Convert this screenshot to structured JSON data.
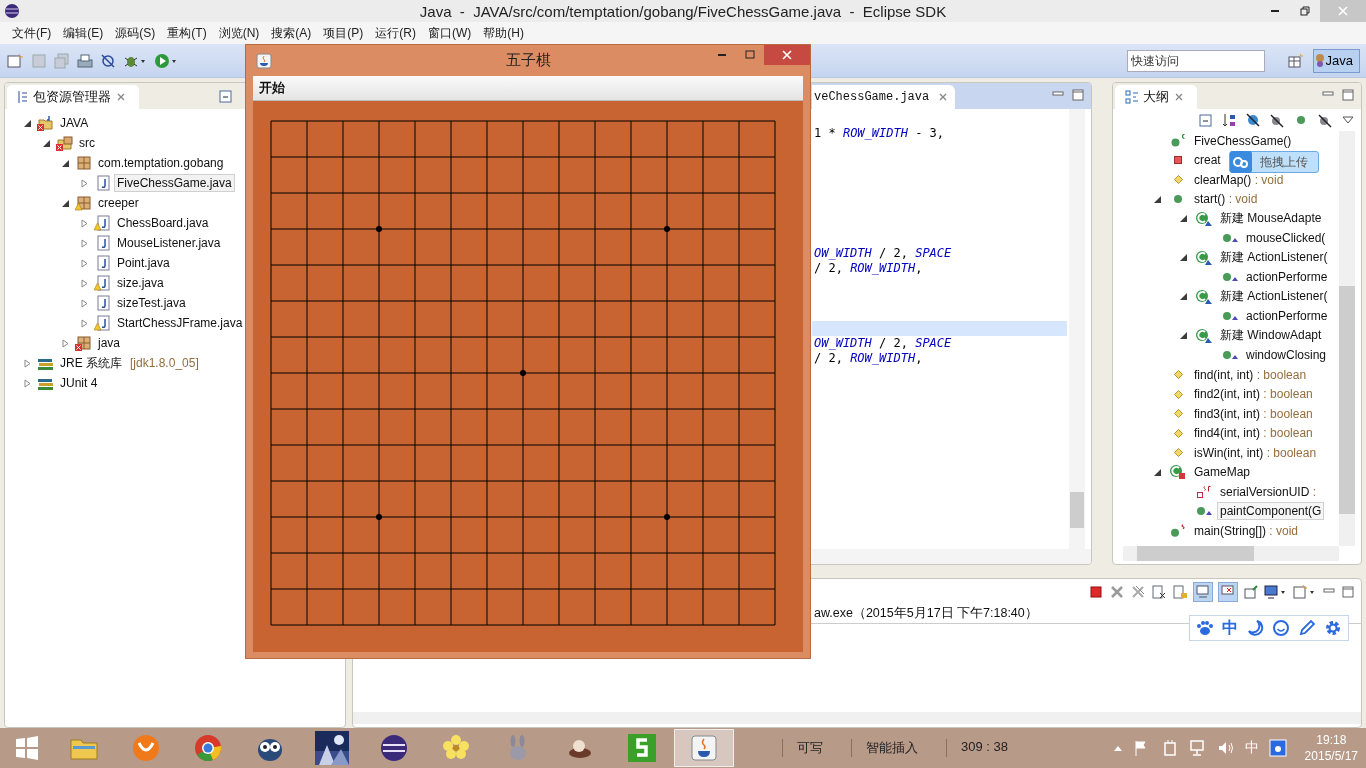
{
  "window": {
    "title": "Java  -  JAVA/src/com/temptation/gobang/FiveChessGame.java  -  Eclipse SDK"
  },
  "menu": [
    "文件(F)",
    "编辑(E)",
    "源码(S)",
    "重构(T)",
    "浏览(N)",
    "搜索(A)",
    "项目(P)",
    "运行(R)",
    "窗口(W)",
    "帮助(H)"
  ],
  "quick_access": {
    "placeholder": "快速访问"
  },
  "perspective": {
    "label": "Java",
    "selected": true
  },
  "package_explorer": {
    "tab": "包资源管理器",
    "tree": [
      {
        "label": "JAVA",
        "kind": "project",
        "error": true,
        "warning": false,
        "expanded": true,
        "selected": false,
        "children": [
          {
            "label": "src",
            "kind": "source-folder",
            "error": true,
            "warning": false,
            "expanded": true,
            "selected": false,
            "children": [
              {
                "label": "com.temptation.gobang",
                "kind": "package",
                "error": false,
                "warning": false,
                "expanded": true,
                "selected": false,
                "children": [
                  {
                    "label": "FiveChessGame.java",
                    "kind": "java-file",
                    "error": false,
                    "warning": false,
                    "expanded": false,
                    "selected": true
                  }
                ]
              },
              {
                "label": "creeper",
                "kind": "package",
                "error": false,
                "warning": true,
                "expanded": true,
                "selected": false,
                "children": [
                  {
                    "label": "ChessBoard.java",
                    "kind": "java-file",
                    "error": false,
                    "warning": true,
                    "expanded": false,
                    "selected": false
                  },
                  {
                    "label": "MouseListener.java",
                    "kind": "java-file",
                    "error": false,
                    "warning": false,
                    "expanded": false,
                    "selected": false
                  },
                  {
                    "label": "Point.java",
                    "kind": "java-file",
                    "error": false,
                    "warning": false,
                    "expanded": false,
                    "selected": false
                  },
                  {
                    "label": "size.java",
                    "kind": "java-file",
                    "error": false,
                    "warning": true,
                    "expanded": false,
                    "selected": false
                  },
                  {
                    "label": "sizeTest.java",
                    "kind": "java-file",
                    "error": false,
                    "warning": false,
                    "expanded": false,
                    "selected": false
                  },
                  {
                    "label": "StartChessJFrame.java",
                    "kind": "java-file",
                    "error": false,
                    "warning": true,
                    "expanded": false,
                    "selected": false
                  }
                ]
              },
              {
                "label": "java",
                "kind": "package",
                "error": true,
                "warning": false,
                "expanded": false,
                "selected": false
              }
            ]
          }
        ]
      },
      {
        "label": "JRE 系统库",
        "suffix": "[jdk1.8.0_05]",
        "kind": "library",
        "error": false,
        "warning": false,
        "expanded": false,
        "selected": false
      },
      {
        "label": "JUnit 4",
        "kind": "library",
        "error": false,
        "warning": false,
        "expanded": false,
        "selected": false
      }
    ]
  },
  "editor": {
    "tab": "veChessGame.java",
    "lines": [
      {
        "current": false,
        "parts": [
          {
            "text": "1 * ",
            "kind": "plain"
          },
          {
            "text": "ROW_WIDTH",
            "kind": "field"
          },
          {
            "text": " - 3,",
            "kind": "plain"
          }
        ]
      },
      {
        "current": false
      },
      {
        "current": false
      },
      {
        "current": false
      },
      {
        "current": false
      },
      {
        "current": false
      },
      {
        "current": false
      },
      {
        "current": false
      },
      {
        "current": false,
        "parts": [
          {
            "text": "OW_WIDTH",
            "kind": "field"
          },
          {
            "text": " / 2, ",
            "kind": "plain"
          },
          {
            "text": "SPACE",
            "kind": "field"
          }
        ]
      },
      {
        "current": false,
        "parts": [
          {
            "text": "/ 2, ",
            "kind": "plain"
          },
          {
            "text": "ROW_WIDTH",
            "kind": "field"
          },
          {
            "text": ",",
            "kind": "plain"
          }
        ]
      },
      {
        "current": false
      },
      {
        "current": false
      },
      {
        "current": false
      },
      {
        "current": true
      },
      {
        "current": false,
        "parts": [
          {
            "text": "OW_WIDTH",
            "kind": "field"
          },
          {
            "text": " / 2, ",
            "kind": "plain"
          },
          {
            "text": "SPACE",
            "kind": "field"
          }
        ]
      },
      {
        "current": false,
        "parts": [
          {
            "text": "/ 2, ",
            "kind": "plain"
          },
          {
            "text": "ROW_WIDTH",
            "kind": "field"
          },
          {
            "text": ",",
            "kind": "plain"
          }
        ]
      }
    ]
  },
  "outline": {
    "tab": "大纲",
    "upload_popup": "拖拽上传",
    "tree": [
      {
        "label": "FiveChessGame()",
        "kind": "constructor",
        "selected": false
      },
      {
        "label": "creat",
        "kind": "private-method",
        "selected": false
      },
      {
        "label": "clearMap()",
        "type": " : void",
        "kind": "default-method",
        "selected": false
      },
      {
        "label": "start()",
        "type": " : void",
        "kind": "public-method",
        "expanded": true,
        "selected": false,
        "children": [
          {
            "label": "新建 MouseAdapte",
            "kind": "anon-class",
            "expanded": true,
            "selected": false,
            "children": [
              {
                "label": "mouseClicked(",
                "kind": "override-method",
                "selected": false
              }
            ]
          },
          {
            "label": "新建 ActionListener(",
            "kind": "anon-class",
            "expanded": true,
            "selected": false,
            "children": [
              {
                "label": "actionPerforme",
                "kind": "override-method",
                "selected": false
              }
            ]
          },
          {
            "label": "新建 ActionListener(",
            "kind": "anon-class",
            "expanded": true,
            "selected": false,
            "children": [
              {
                "label": "actionPerforme",
                "kind": "override-method",
                "selected": false
              }
            ]
          },
          {
            "label": "新建 WindowAdapt",
            "kind": "anon-class",
            "expanded": true,
            "selected": false,
            "children": [
              {
                "label": "windowClosing",
                "kind": "override-method",
                "selected": false
              }
            ]
          }
        ]
      },
      {
        "label": "find(int, int)",
        "type": " : boolean",
        "kind": "default-method",
        "selected": false
      },
      {
        "label": "find2(int, int)",
        "type": " : boolean",
        "kind": "default-method",
        "selected": false
      },
      {
        "label": "find3(int, int)",
        "type": " : boolean",
        "kind": "default-method",
        "selected": false
      },
      {
        "label": "find4(int, int)",
        "type": " : boolean",
        "kind": "default-method",
        "selected": false
      },
      {
        "label": "isWin(int, int)",
        "type": " : boolean",
        "kind": "default-method",
        "selected": false
      },
      {
        "label": "GameMap",
        "kind": "class",
        "expanded": true,
        "selected": false,
        "children": [
          {
            "label": "serialVersionUID",
            "type": " :",
            "kind": "field",
            "selected": false
          },
          {
            "label": "paintComponent(G",
            "kind": "override-method",
            "selected": true
          }
        ]
      },
      {
        "label": "main(String[])",
        "type": " : void",
        "kind": "static-method",
        "selected": false
      }
    ]
  },
  "console": {
    "text": "aw.exe（2015年5月17日 下午7:18:40）"
  },
  "ime_toolbar": {
    "mode": "中"
  },
  "game_window": {
    "title": "五子棋",
    "menu": [
      "开始"
    ]
  },
  "taskbar": {
    "apps": [
      {
        "kind": "folder",
        "selected": false
      },
      {
        "kind": "browser",
        "selected": false
      },
      {
        "kind": "chrome",
        "selected": false
      },
      {
        "kind": "owl",
        "selected": false
      },
      {
        "kind": "picture",
        "selected": false
      },
      {
        "kind": "eclipse",
        "selected": false
      },
      {
        "kind": "flower",
        "selected": false
      },
      {
        "kind": "rabbit",
        "selected": false
      },
      {
        "kind": "figure",
        "selected": false
      },
      {
        "kind": "five",
        "selected": false
      },
      {
        "kind": "java",
        "selected": true
      }
    ],
    "status_bar": [
      "可写",
      "智能插入",
      "309 : 38"
    ],
    "tray": {
      "ime": "中",
      "time": "19:18",
      "date": "2015/5/17"
    }
  }
}
